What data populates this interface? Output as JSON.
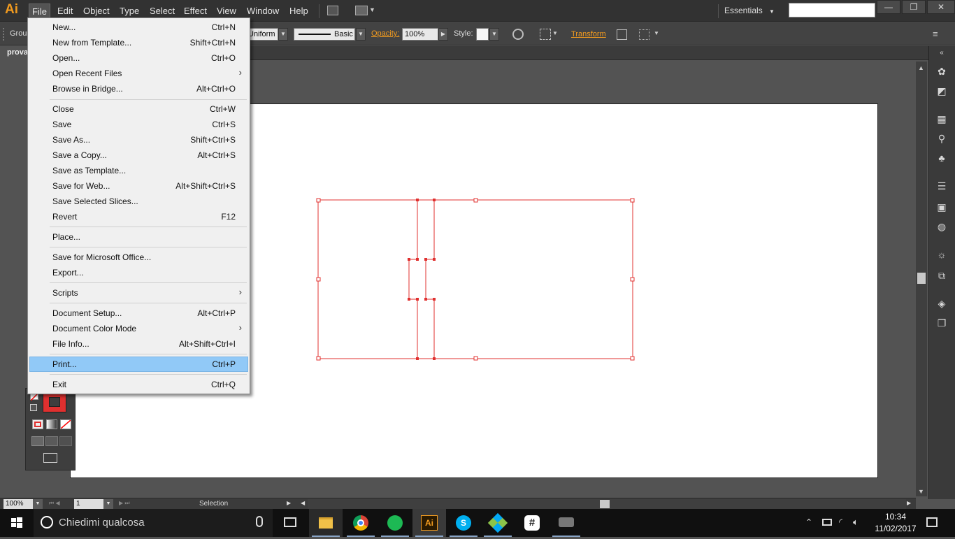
{
  "app": {
    "logo": "Ai"
  },
  "menubar": {
    "items": [
      "File",
      "Edit",
      "Object",
      "Type",
      "Select",
      "Effect",
      "View",
      "Window",
      "Help"
    ],
    "workspace": "Essentials",
    "search_value": ""
  },
  "window_controls": {
    "minimize": "—",
    "restore": "❐",
    "close": "✕"
  },
  "controlbar": {
    "group_label": "Group",
    "stroke_profile": "Uniform",
    "brush": "Basic",
    "opacity_label": "Opacity:",
    "opacity_value": "100%",
    "style_label": "Style:",
    "transform_label": "Transform"
  },
  "document": {
    "tab_title": "prova"
  },
  "file_menu": {
    "items": [
      {
        "label": "New...",
        "shortcut": "Ctrl+N"
      },
      {
        "label": "New from Template...",
        "shortcut": "Shift+Ctrl+N"
      },
      {
        "label": "Open...",
        "shortcut": "Ctrl+O"
      },
      {
        "label": "Open Recent Files",
        "shortcut": ""
      },
      {
        "label": "Browse in Bridge...",
        "shortcut": "Alt+Ctrl+O"
      },
      {
        "label": "Close",
        "shortcut": "Ctrl+W"
      },
      {
        "label": "Save",
        "shortcut": "Ctrl+S"
      },
      {
        "label": "Save As...",
        "shortcut": "Shift+Ctrl+S"
      },
      {
        "label": "Save a Copy...",
        "shortcut": "Alt+Ctrl+S"
      },
      {
        "label": "Save as Template...",
        "shortcut": ""
      },
      {
        "label": "Save for Web...",
        "shortcut": "Alt+Shift+Ctrl+S"
      },
      {
        "label": "Save Selected Slices...",
        "shortcut": ""
      },
      {
        "label": "Revert",
        "shortcut": "F12"
      },
      {
        "label": "Place...",
        "shortcut": ""
      },
      {
        "label": "Save for Microsoft Office...",
        "shortcut": ""
      },
      {
        "label": "Export...",
        "shortcut": ""
      },
      {
        "label": "Scripts",
        "shortcut": ""
      },
      {
        "label": "Document Setup...",
        "shortcut": "Alt+Ctrl+P"
      },
      {
        "label": "Document Color Mode",
        "shortcut": ""
      },
      {
        "label": "File Info...",
        "shortcut": "Alt+Shift+Ctrl+I"
      },
      {
        "label": "Print...",
        "shortcut": "Ctrl+P"
      },
      {
        "label": "Exit",
        "shortcut": "Ctrl+Q"
      }
    ],
    "highlighted": "Print..."
  },
  "statusbar": {
    "zoom": "100%",
    "artboard_number": "1",
    "status_text": "Selection"
  },
  "taskbar": {
    "search_placeholder": "Chiedimi qualcosa",
    "apps": [
      "file-explorer",
      "chrome",
      "spotify",
      "illustrator",
      "skype",
      "app-5",
      "slack",
      "app-7"
    ],
    "illustrator_label": "Ai",
    "time": "10:34",
    "date": "11/02/2017"
  },
  "colors": {
    "selection": "#e0302f",
    "menu_highlight": "#91c9f7",
    "ai_orange": "#f29b1f",
    "ui_dark": "#535353"
  }
}
